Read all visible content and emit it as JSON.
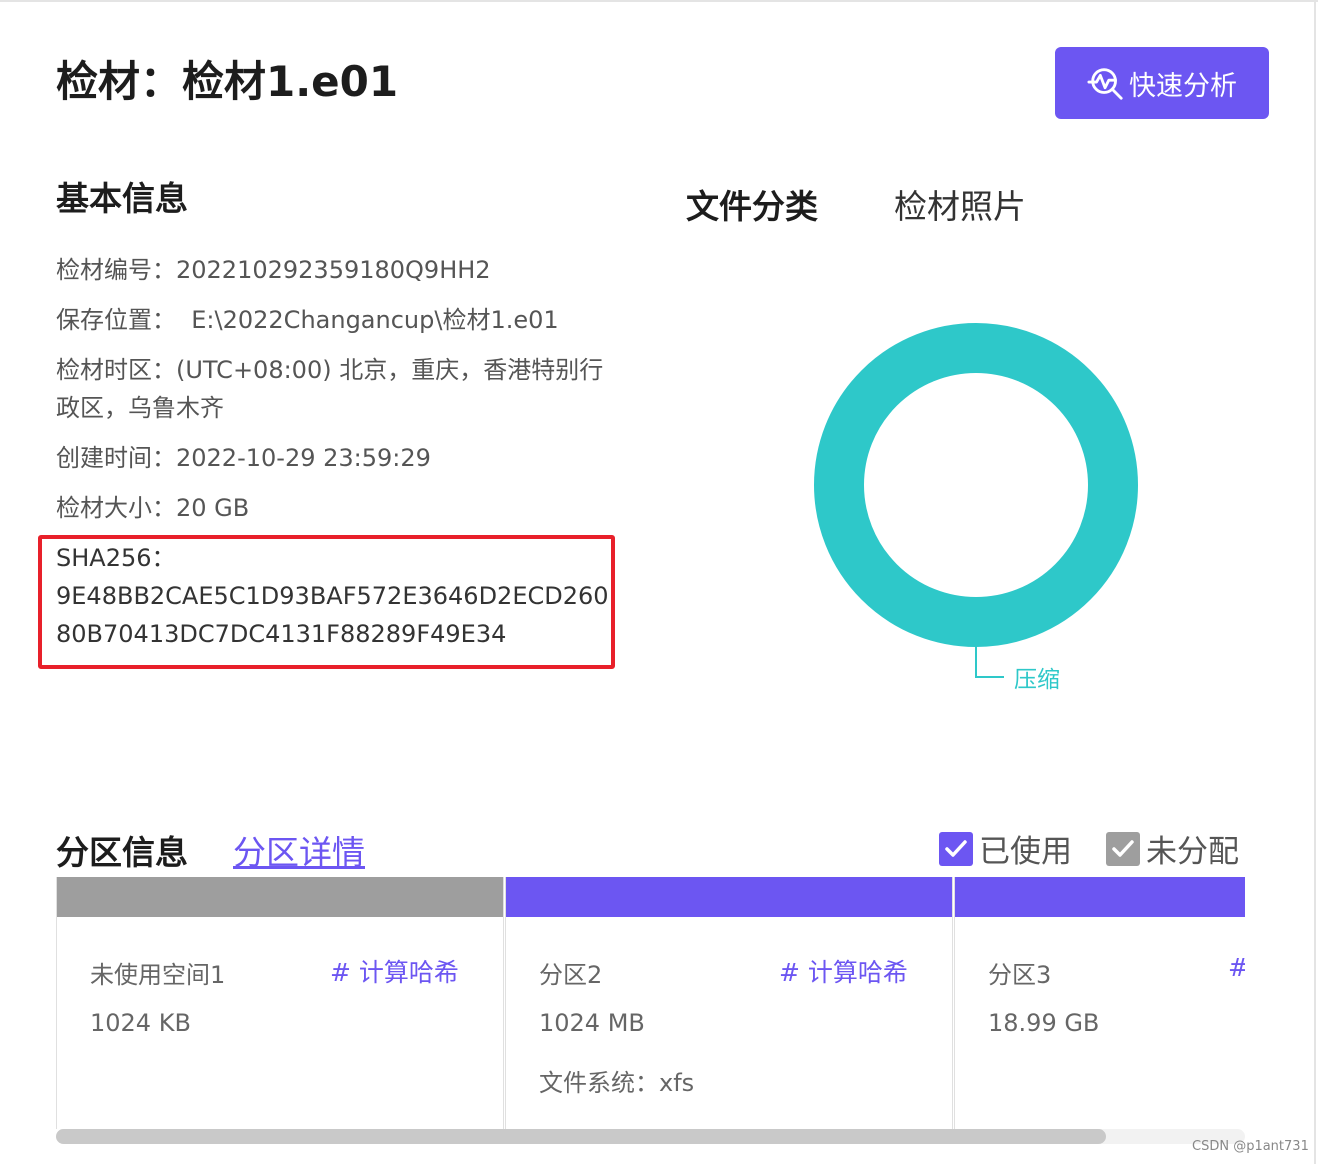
{
  "header": {
    "title": "检材：检材1.e01",
    "quick_button_label": "快速分析"
  },
  "basic_info": {
    "section_title": "基本信息",
    "id_key": "检材编号：",
    "id_value": "202210292359180Q9HH2",
    "path_key": "保存位置：",
    "path_value": "E:\\2022Changancup\\检材1.e01",
    "timezone_key": "检材时区：",
    "timezone_value": "(UTC+08:00) 北京，重庆，香港特别行政区，乌鲁木齐",
    "created_key": "创建时间：",
    "created_value": "2022-10-29 23:59:29",
    "size_key": "检材大小：",
    "size_value": "20 GB",
    "sha_key": "SHA256：",
    "sha_line1": "9E48BB2CAE5C1D93BAF572E3646D2ECD260",
    "sha_line2": "80B70413DC7DC4131F88289F49E34"
  },
  "file_category": {
    "title": "文件分类",
    "tab_photo": "检材照片",
    "donut_label": "压缩",
    "donut_color": "#2ec8c9"
  },
  "partitions": {
    "section_title": "分区信息",
    "detail_link": "分区详情",
    "legend_used": "已使用",
    "legend_unallocated": "未分配",
    "used_color": "#6c56f2",
    "unallocated_color": "#9e9e9e",
    "items": [
      {
        "name": "未使用空间1",
        "size": "1024 KB",
        "hash_label": "# 计算哈希",
        "fs": "",
        "status": "unallocated"
      },
      {
        "name": "分区2",
        "size": "1024 MB",
        "hash_label": "# 计算哈希",
        "fs": "文件系统：xfs",
        "status": "used"
      },
      {
        "name": "分区3",
        "size": "18.99 GB",
        "hash_label": "#",
        "fs": "",
        "status": "used"
      }
    ]
  },
  "watermark": "CSDN @p1ant731"
}
